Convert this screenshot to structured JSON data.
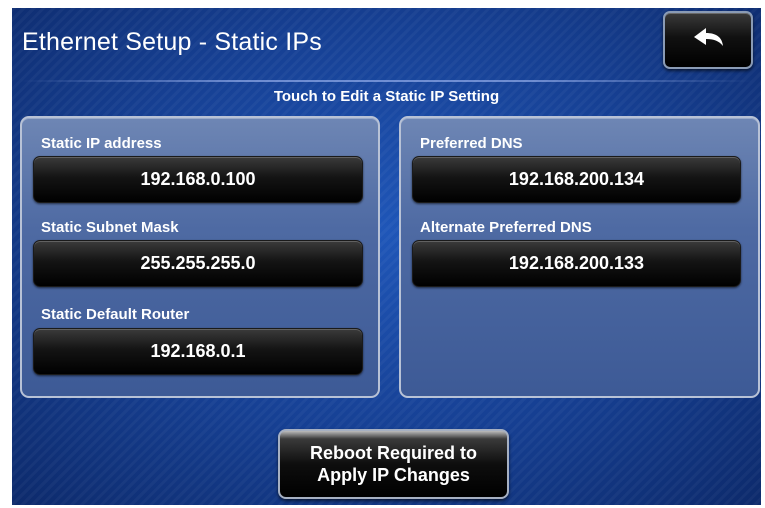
{
  "header": {
    "title": "Ethernet Setup - Static IPs",
    "back_icon": "back-arrow-icon"
  },
  "subtitle": "Touch to Edit a Static IP Setting",
  "left_panel": {
    "fields": [
      {
        "label": "Static IP address",
        "value": "192.168.0.100"
      },
      {
        "label": "Static Subnet Mask",
        "value": "255.255.255.0"
      },
      {
        "label": "Static Default Router",
        "value": "192.168.0.1"
      }
    ]
  },
  "right_panel": {
    "fields": [
      {
        "label": "Preferred DNS",
        "value": "192.168.200.134"
      },
      {
        "label": "Alternate Preferred DNS",
        "value": "192.168.200.133"
      }
    ]
  },
  "reboot_button": {
    "line1": "Reboot Required to",
    "line2": "Apply IP Changes"
  },
  "colors": {
    "background": "#163f92",
    "panel": "#4e6aa3",
    "button": "#000000",
    "text": "#ffffff"
  }
}
